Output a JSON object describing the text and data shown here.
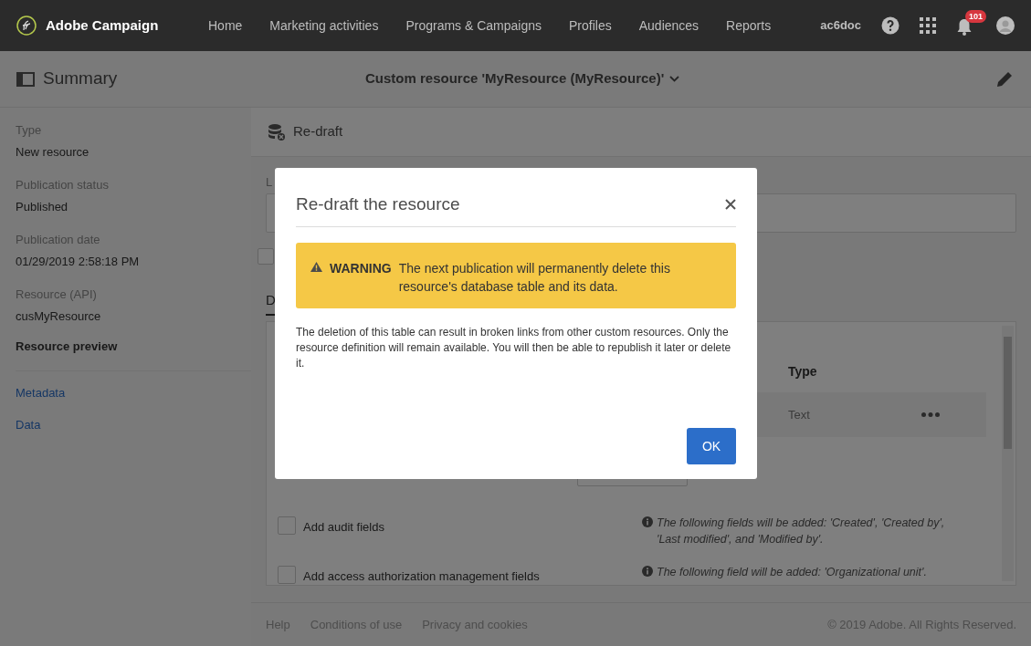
{
  "header": {
    "brand": "Adobe Campaign",
    "nav": [
      "Home",
      "Marketing activities",
      "Programs & Campaigns",
      "Profiles",
      "Audiences",
      "Reports"
    ],
    "user": "ac6doc",
    "notification_count": "101"
  },
  "summary_bar": {
    "title": "Summary",
    "resource_title": "Custom resource 'MyResource (MyResource)'"
  },
  "sidebar": {
    "fields": [
      {
        "label": "Type",
        "value": "New resource"
      },
      {
        "label": "Publication status",
        "value": "Published"
      },
      {
        "label": "Publication date",
        "value": "01/29/2019 2:58:18 PM"
      },
      {
        "label": "Resource (API)",
        "value": "cusMyResource"
      }
    ],
    "section": "Resource preview",
    "links": [
      "Metadata",
      "Data"
    ]
  },
  "toolbar": {
    "action": "Re-draft"
  },
  "content": {
    "field_label": "L",
    "checkbox_checked": false,
    "tab": "D",
    "table": {
      "columns": [
        "Type"
      ],
      "rows": [
        [
          "Text"
        ]
      ]
    },
    "options": [
      {
        "label": "Add audit fields",
        "checked": false,
        "note": "The following fields will be added: 'Created', 'Created by', 'Last modified', and 'Modified by'."
      },
      {
        "label": "Add access authorization management fields",
        "checked": false,
        "note": "The following field will be added: 'Organizational unit'."
      }
    ]
  },
  "footer": {
    "links": [
      "Help",
      "Conditions of use",
      "Privacy and cookies"
    ],
    "copyright": "© 2019 Adobe. All Rights Reserved."
  },
  "dialog": {
    "title": "Re-draft the resource",
    "warning": {
      "label": "WARNING",
      "text": "The next publication will permanently delete this resource's database table and its data."
    },
    "body": "The deletion of this table can result in broken links from other custom resources. Only the resource definition will remain available. You will then be able to republish it later or delete it.",
    "buttons": [
      "OK"
    ]
  }
}
